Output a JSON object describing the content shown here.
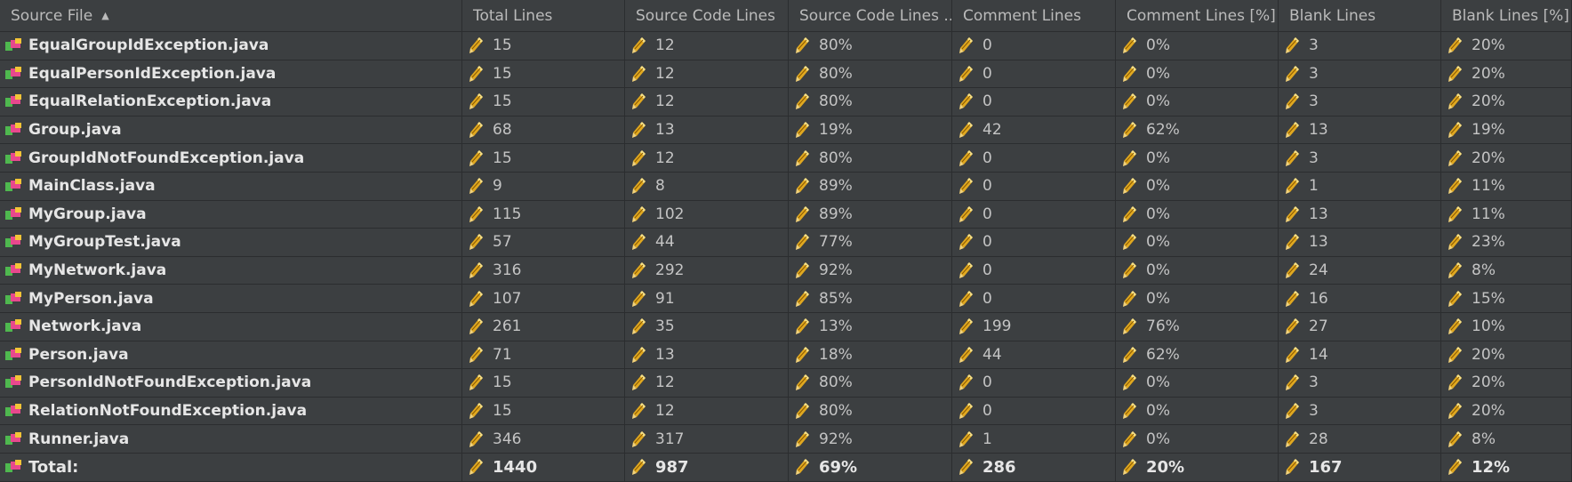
{
  "columns": [
    "Source File",
    "Total Lines",
    "Source Code Lines",
    "Source Code Lines ...",
    "Comment Lines",
    "Comment Lines [%]",
    "Blank Lines",
    "Blank Lines [%]"
  ],
  "rows": [
    {
      "file": "EqualGroupIdException.java",
      "total": "15",
      "code": "12",
      "code_pct": "80%",
      "comment": "0",
      "comment_pct": "0%",
      "blank": "3",
      "blank_pct": "20%"
    },
    {
      "file": "EqualPersonIdException.java",
      "total": "15",
      "code": "12",
      "code_pct": "80%",
      "comment": "0",
      "comment_pct": "0%",
      "blank": "3",
      "blank_pct": "20%"
    },
    {
      "file": "EqualRelationException.java",
      "total": "15",
      "code": "12",
      "code_pct": "80%",
      "comment": "0",
      "comment_pct": "0%",
      "blank": "3",
      "blank_pct": "20%"
    },
    {
      "file": "Group.java",
      "total": "68",
      "code": "13",
      "code_pct": "19%",
      "comment": "42",
      "comment_pct": "62%",
      "blank": "13",
      "blank_pct": "19%"
    },
    {
      "file": "GroupIdNotFoundException.java",
      "total": "15",
      "code": "12",
      "code_pct": "80%",
      "comment": "0",
      "comment_pct": "0%",
      "blank": "3",
      "blank_pct": "20%"
    },
    {
      "file": "MainClass.java",
      "total": "9",
      "code": "8",
      "code_pct": "89%",
      "comment": "0",
      "comment_pct": "0%",
      "blank": "1",
      "blank_pct": "11%"
    },
    {
      "file": "MyGroup.java",
      "total": "115",
      "code": "102",
      "code_pct": "89%",
      "comment": "0",
      "comment_pct": "0%",
      "blank": "13",
      "blank_pct": "11%"
    },
    {
      "file": "MyGroupTest.java",
      "total": "57",
      "code": "44",
      "code_pct": "77%",
      "comment": "0",
      "comment_pct": "0%",
      "blank": "13",
      "blank_pct": "23%"
    },
    {
      "file": "MyNetwork.java",
      "total": "316",
      "code": "292",
      "code_pct": "92%",
      "comment": "0",
      "comment_pct": "0%",
      "blank": "24",
      "blank_pct": "8%"
    },
    {
      "file": "MyPerson.java",
      "total": "107",
      "code": "91",
      "code_pct": "85%",
      "comment": "0",
      "comment_pct": "0%",
      "blank": "16",
      "blank_pct": "15%"
    },
    {
      "file": "Network.java",
      "total": "261",
      "code": "35",
      "code_pct": "13%",
      "comment": "199",
      "comment_pct": "76%",
      "blank": "27",
      "blank_pct": "10%"
    },
    {
      "file": "Person.java",
      "total": "71",
      "code": "13",
      "code_pct": "18%",
      "comment": "44",
      "comment_pct": "62%",
      "blank": "14",
      "blank_pct": "20%"
    },
    {
      "file": "PersonIdNotFoundException.java",
      "total": "15",
      "code": "12",
      "code_pct": "80%",
      "comment": "0",
      "comment_pct": "0%",
      "blank": "3",
      "blank_pct": "20%"
    },
    {
      "file": "RelationNotFoundException.java",
      "total": "15",
      "code": "12",
      "code_pct": "80%",
      "comment": "0",
      "comment_pct": "0%",
      "blank": "3",
      "blank_pct": "20%"
    },
    {
      "file": "Runner.java",
      "total": "346",
      "code": "317",
      "code_pct": "92%",
      "comment": "1",
      "comment_pct": "0%",
      "blank": "28",
      "blank_pct": "8%"
    }
  ],
  "total": {
    "file": "Total:",
    "total": "1440",
    "code": "987",
    "code_pct": "69%",
    "comment": "286",
    "comment_pct": "20%",
    "blank": "167",
    "blank_pct": "12%"
  },
  "icons": {
    "file": "java-class-icon",
    "metric": "pencil-icon",
    "sort": "sort-ascending-icon"
  },
  "colors": {
    "background": "#3c3f41",
    "grid": "#2b2d2f",
    "text": "#bbbbbb"
  }
}
